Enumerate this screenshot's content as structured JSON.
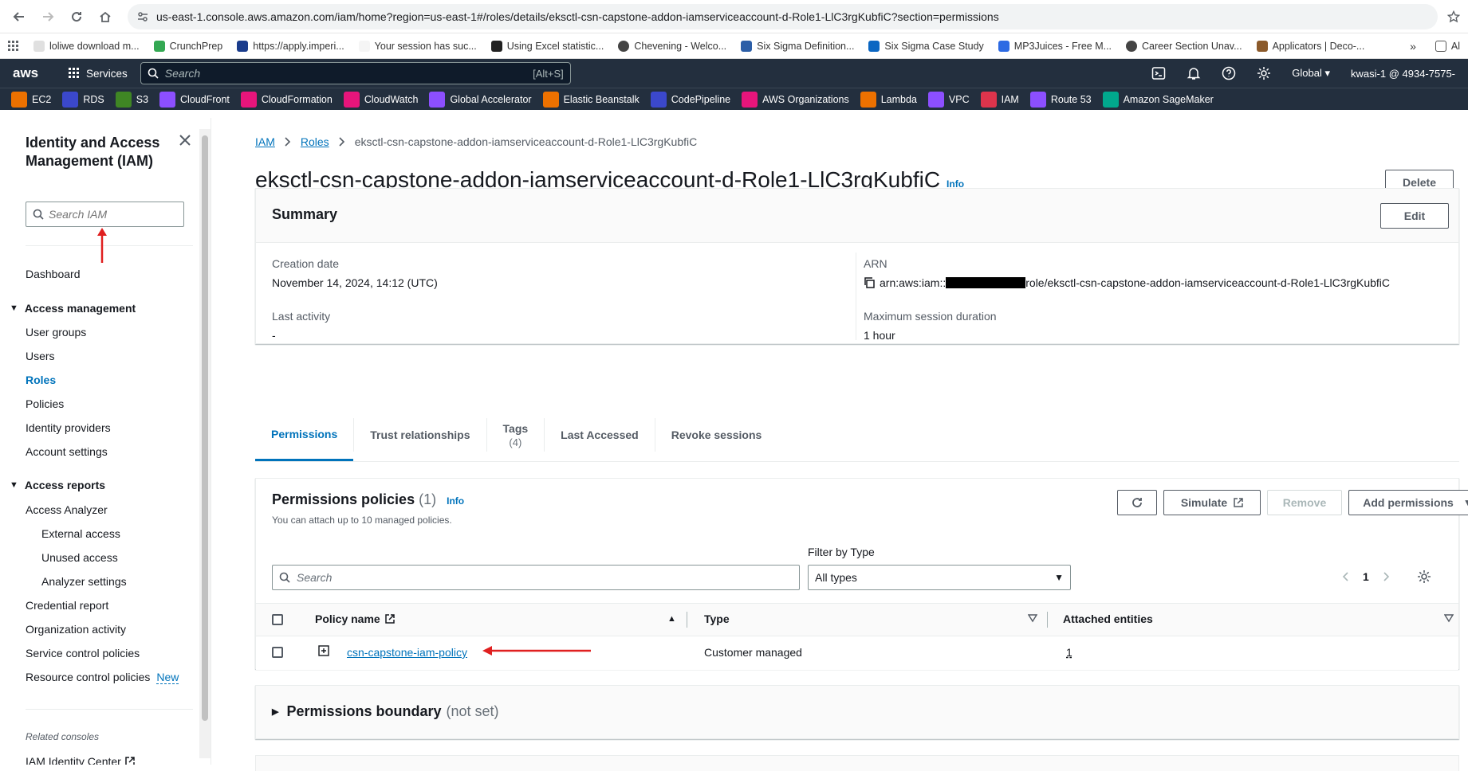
{
  "browser": {
    "url": "us-east-1.console.aws.amazon.com/iam/home?region=us-east-1#/roles/details/eksctl-csn-capstone-addon-iamserviceaccount-d-Role1-LlC3rgKubfiC?section=permissions",
    "bookmarks": [
      "loliwe download m...",
      "CrunchPrep",
      "https://apply.imperi...",
      "Your session has suc...",
      "Using Excel statistic...",
      "Chevening - Welco...",
      "Six Sigma Definition...",
      "Six Sigma Case Study",
      "MP3Juices - Free M...",
      "Career Section Unav...",
      "Applicators | Deco-..."
    ],
    "bookmarks_more": "»",
    "bookmarks_trailing": "Al"
  },
  "aws_nav": {
    "logo": "aws",
    "services_label": "Services",
    "search_placeholder": "Search",
    "search_shortcut": "[Alt+S]",
    "region": "Global ▾",
    "account": "kwasi-1 @ 4934-7575-"
  },
  "favorites": [
    {
      "label": "EC2",
      "color": "#ed7100"
    },
    {
      "label": "RDS",
      "color": "#3b48cc"
    },
    {
      "label": "S3",
      "color": "#3f8624"
    },
    {
      "label": "CloudFront",
      "color": "#8c4fff"
    },
    {
      "label": "CloudFormation",
      "color": "#e7157b"
    },
    {
      "label": "CloudWatch",
      "color": "#e7157b"
    },
    {
      "label": "Global Accelerator",
      "color": "#8c4fff"
    },
    {
      "label": "Elastic Beanstalk",
      "color": "#ed7100"
    },
    {
      "label": "CodePipeline",
      "color": "#3b48cc"
    },
    {
      "label": "AWS Organizations",
      "color": "#e7157b"
    },
    {
      "label": "Lambda",
      "color": "#ed7100"
    },
    {
      "label": "VPC",
      "color": "#8c4fff"
    },
    {
      "label": "IAM",
      "color": "#dd344c"
    },
    {
      "label": "Route 53",
      "color": "#8c4fff"
    },
    {
      "label": "Amazon SageMaker",
      "color": "#01a88d"
    }
  ],
  "sidebar": {
    "title": "Identity and Access Management (IAM)",
    "search_placeholder": "Search IAM",
    "dashboard": "Dashboard",
    "access_management": "Access management",
    "user_groups": "User groups",
    "users": "Users",
    "roles": "Roles",
    "policies": "Policies",
    "identity_providers": "Identity providers",
    "account_settings": "Account settings",
    "access_reports": "Access reports",
    "access_analyzer": "Access Analyzer",
    "external_access": "External access",
    "unused_access": "Unused access",
    "analyzer_settings": "Analyzer settings",
    "credential_report": "Credential report",
    "organization_activity": "Organization activity",
    "service_control_policies": "Service control policies",
    "resource_control_policies": "Resource control policies",
    "new_badge": "New",
    "related_consoles": "Related consoles",
    "iam_identity_center": "IAM Identity Center"
  },
  "breadcrumb": {
    "iam": "IAM",
    "roles": "Roles",
    "current": "eksctl-csn-capstone-addon-iamserviceaccount-d-Role1-LlC3rgKubfiC"
  },
  "page": {
    "title": "eksctl-csn-capstone-addon-iamserviceaccount-d-Role1-LlC3rgKubfiC",
    "info": "Info",
    "delete": "Delete"
  },
  "summary": {
    "heading": "Summary",
    "edit": "Edit",
    "creation_date_label": "Creation date",
    "creation_date": "November 14, 2024, 14:12 (UTC)",
    "last_activity_label": "Last activity",
    "last_activity": "-",
    "arn_label": "ARN",
    "arn_prefix": "arn:aws:iam::",
    "arn_suffix": "role/eksctl-csn-capstone-addon-iamserviceaccount-d-Role1-LlC3rgKubfiC",
    "max_session_label": "Maximum session duration",
    "max_session": "1 hour"
  },
  "tabs": {
    "permissions": "Permissions",
    "trust": "Trust relationships",
    "tags": "Tags",
    "tags_count": "(4)",
    "last_accessed": "Last Accessed",
    "revoke": "Revoke sessions"
  },
  "permissions": {
    "heading": "Permissions policies",
    "count": "(1)",
    "info": "Info",
    "hint": "You can attach up to 10 managed policies.",
    "simulate": "Simulate",
    "remove": "Remove",
    "add": "Add permissions",
    "filter_label": "Filter by Type",
    "search_placeholder": "Search",
    "type_value": "All types",
    "page": "1",
    "col_name": "Policy name",
    "col_type": "Type",
    "col_entities": "Attached entities",
    "rows": [
      {
        "name": "csn-capstone-iam-policy",
        "type": "Customer managed",
        "entities": "1"
      }
    ]
  },
  "boundary": {
    "heading": "Permissions boundary",
    "status": "(not set)"
  }
}
